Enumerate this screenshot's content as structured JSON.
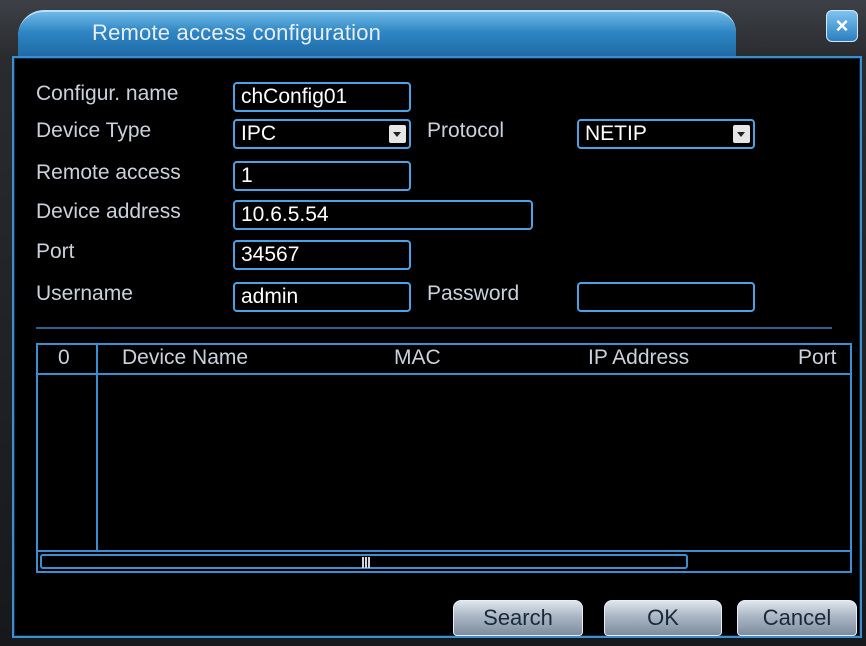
{
  "window": {
    "title": "Remote access configuration",
    "close_label": "×"
  },
  "form": {
    "config_name_label": "Configur. name",
    "config_name_value": "chConfig01",
    "device_type_label": "Device Type",
    "device_type_value": "IPC",
    "protocol_label": "Protocol",
    "protocol_value": "NETIP",
    "remote_access_label": "Remote access",
    "remote_access_value": "1",
    "device_address_label": "Device address",
    "device_address_value": "10.6.5.54",
    "port_label": "Port",
    "port_value": "34567",
    "username_label": "Username",
    "username_value": "admin",
    "password_label": "Password",
    "password_value": ""
  },
  "table": {
    "columns": [
      "0",
      "Device Name",
      "MAC",
      "IP Address",
      "Port"
    ],
    "rows": []
  },
  "buttons": {
    "search": "Search",
    "ok": "OK",
    "cancel": "Cancel"
  },
  "colors": {
    "accent": "#3b8fd0",
    "title_tab": "#2f86c4",
    "background": "#000000"
  }
}
